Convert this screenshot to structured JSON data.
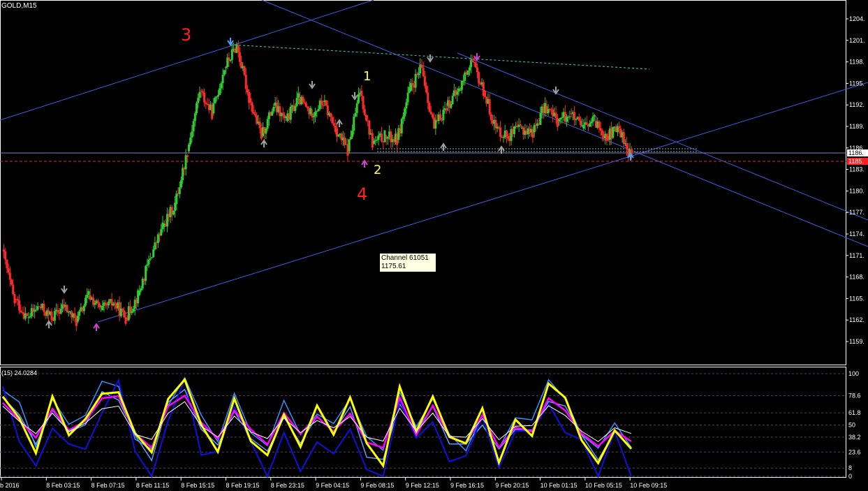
{
  "chart_title": "GOLD,M15",
  "indicator_title": "(15) 24.0284",
  "tooltip": {
    "line1": "Channel 61051",
    "line2": "1175.61"
  },
  "wave_labels": [
    {
      "id": "wave-3",
      "text": "3",
      "color": "#ff2020"
    },
    {
      "id": "wave-4",
      "text": "4",
      "color": "#ff2020"
    },
    {
      "id": "wave-1",
      "text": "1",
      "color": "#ffff40"
    },
    {
      "id": "wave-2",
      "text": "2",
      "color": "#ffff40"
    }
  ],
  "price_axis": {
    "ticks": [
      "1204.",
      "1201.",
      "1198.",
      "1195.",
      "1192.",
      "1189.",
      "1186.",
      "1183.",
      "1180.",
      "1177.",
      "1174.",
      "1171.",
      "1168.",
      "1165.",
      "1162.",
      "1159."
    ],
    "current_price_label": "1186.",
    "bid_label": "1185."
  },
  "indicator_axis": {
    "ticks": [
      "100",
      "78.6",
      "61.8",
      "50",
      "38.2",
      "23.6",
      "8",
      "0"
    ]
  },
  "time_axis": {
    "ticks": [
      "b 2016",
      "8 Feb 03:15",
      "8 Feb 07:15",
      "8 Feb 11:15",
      "8 Feb 15:15",
      "8 Feb 19:15",
      "8 Feb 23:15",
      "9 Feb 04:15",
      "9 Feb 08:15",
      "9 Feb 12:15",
      "9 Feb 16:15",
      "9 Feb 20:15",
      "10 Feb 01:15",
      "10 Feb 05:15",
      "10 Feb 09:15"
    ]
  },
  "colors": {
    "background": "#000000",
    "bull_candle": "#32cd32",
    "bear_candle": "#ff2a2a",
    "channel_line": "#3b5fe0",
    "grid_text": "#ffffff",
    "price_line": "#8080c0",
    "bid_line": "#ff2020",
    "osc_main": "#ffff00",
    "osc_magenta": "#ff00ff",
    "osc_blue": "#1010e0",
    "osc_light": "#3a8fff"
  },
  "chart_data": {
    "type": "candlestick",
    "symbol": "GOLD",
    "timeframe": "M15",
    "ylim": [
      1159,
      1206
    ],
    "price_path": [
      [
        1174,
        1167
      ],
      [
        1167.5,
        1165
      ],
      [
        1165,
        1166.5
      ],
      [
        1166.5,
        1165
      ],
      [
        1165,
        1166.5
      ],
      [
        1166.5,
        1164.5
      ],
      [
        1164.5,
        1168
      ],
      [
        1168,
        1166
      ],
      [
        1166,
        1167
      ],
      [
        1167,
        1165
      ],
      [
        1165,
        1168
      ],
      [
        1168,
        1173
      ],
      [
        1173,
        1177
      ],
      [
        1177,
        1180
      ],
      [
        1180,
        1187
      ],
      [
        1187,
        1195
      ],
      [
        1195,
        1192
      ],
      [
        1192,
        1198
      ],
      [
        1198,
        1201
      ],
      [
        1201,
        1194
      ],
      [
        1194,
        1189
      ],
      [
        1189,
        1193
      ],
      [
        1193,
        1191
      ],
      [
        1191,
        1194
      ],
      [
        1194,
        1192
      ],
      [
        1192,
        1193.5
      ],
      [
        1193.5,
        1190
      ],
      [
        1190,
        1187
      ],
      [
        1187,
        1195
      ],
      [
        1195,
        1188
      ],
      [
        1188,
        1189
      ],
      [
        1189,
        1188.5
      ],
      [
        1188.5,
        1195
      ],
      [
        1195,
        1198
      ],
      [
        1198,
        1190
      ],
      [
        1190,
        1193
      ],
      [
        1193,
        1195
      ],
      [
        1195,
        1199
      ],
      [
        1199,
        1195
      ],
      [
        1195,
        1190
      ],
      [
        1190,
        1189
      ],
      [
        1189,
        1190
      ],
      [
        1190,
        1189.5
      ],
      [
        1189.5,
        1193
      ],
      [
        1193,
        1191
      ],
      [
        1191,
        1192
      ],
      [
        1192,
        1190
      ],
      [
        1190,
        1191
      ],
      [
        1191,
        1189
      ],
      [
        1189,
        1190
      ],
      [
        1190,
        1186
      ]
    ],
    "indicator": {
      "name": "Stochastic",
      "value": 24.0284,
      "main": [
        85,
        60,
        30,
        70,
        40,
        55,
        85,
        90,
        35,
        20,
        75,
        95,
        50,
        30,
        70,
        40,
        20,
        65,
        35,
        60,
        45,
        70,
        25,
        15,
        85,
        40,
        75,
        30,
        25,
        60,
        20,
        50,
        45,
        85,
        70,
        40,
        20,
        45,
        30
      ]
    }
  }
}
